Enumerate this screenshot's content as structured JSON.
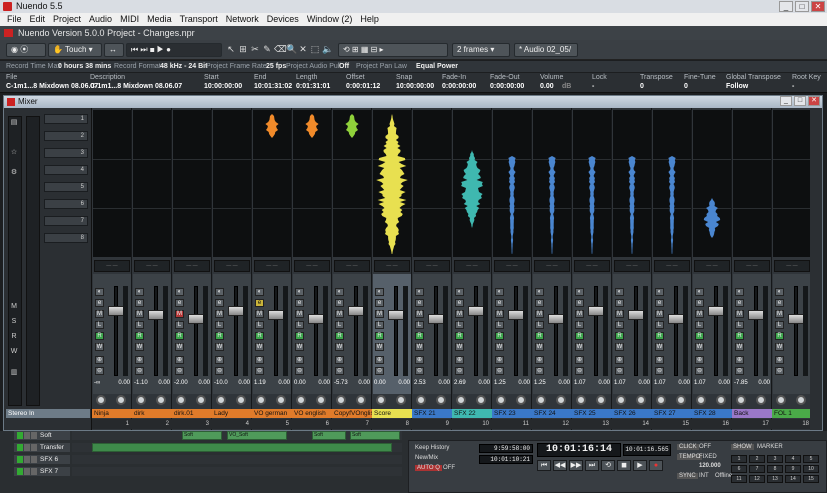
{
  "app": {
    "title": "Nuendo 5.5",
    "project_title": "Nuendo Version 5.0.0 Project - Changes.npr"
  },
  "menu": [
    "File",
    "Edit",
    "Project",
    "Audio",
    "MIDI",
    "Media",
    "Transport",
    "Network",
    "Devices",
    "Window (2)",
    "Help"
  ],
  "toolbar": {
    "automation_mode": "Touch",
    "frames": "2 frames",
    "audio_track": "* Audio 02_05/"
  },
  "status": [
    {
      "label": "Record Time Max",
      "value": "0 hours 38 mins"
    },
    {
      "label": "Record Format",
      "value": "48 kHz - 24 Bit"
    },
    {
      "label": "Project Frame Rate",
      "value": "25 fps"
    },
    {
      "label": "Project Audio Pull",
      "value": "Off"
    },
    {
      "label": "Project Pan Law",
      "value": "Equal Power"
    }
  ],
  "info": {
    "headers": [
      "File",
      "Description",
      "Start",
      "End",
      "Length",
      "Offset",
      "Snap",
      "Fade-In",
      "Fade-Out",
      "Volume",
      "Lock",
      "Transpose",
      "Fine-Tune",
      "Global Transpose",
      "Root Key"
    ],
    "values": [
      "C-1m1...8 Mixdown 08.06.07",
      "C-1m1...8 Mixdown 08.06.07",
      "10:00:00:00",
      "10:01:31:02",
      "0:01:31:01",
      "0:00:01:12",
      "10:00:00:00",
      "0:00:00:00",
      "0:00:00:00",
      "0.00",
      "-",
      "0",
      "0",
      "Follow",
      "-"
    ],
    "volume_unit": "dB"
  },
  "mixer": {
    "title": "Mixer",
    "channels": [
      {
        "name": "Ninja",
        "num": "1",
        "left": "-∞",
        "right": "0.00",
        "color": "#e07b2a",
        "wave": "none",
        "waveColor": "#e07b2a"
      },
      {
        "name": "dirk",
        "num": "2",
        "left": "-1.10",
        "right": "0.00",
        "color": "#e07b2a",
        "wave": "none",
        "waveColor": "#e07b2a"
      },
      {
        "name": "dirk.01",
        "num": "3",
        "left": "-2.00",
        "right": "0.00",
        "color": "#e07b2a",
        "wave": "none",
        "waveColor": "#e07b2a"
      },
      {
        "name": "Lady",
        "num": "4",
        "left": "-10.0",
        "right": "0.00",
        "color": "#e07b2a",
        "wave": "none",
        "waveColor": "#e07b2a"
      },
      {
        "name": "VO german",
        "num": "5",
        "left": "1.19",
        "right": "0.00",
        "color": "#e07b2a",
        "wave": "top",
        "waveColor": "#f08a2a"
      },
      {
        "name": "VO english",
        "num": "6",
        "left": "0.00",
        "right": "0.00",
        "color": "#e07b2a",
        "wave": "top",
        "waveColor": "#f08a2a"
      },
      {
        "name": "CopyfVOnglish",
        "num": "7",
        "left": "-5.73",
        "right": "0.00",
        "color": "#e07b2a",
        "wave": "top",
        "waveColor": "#8fd13a"
      },
      {
        "name": "Score",
        "num": "8",
        "left": "0.00",
        "right": "0.00",
        "color": "#e8e050",
        "wave": "full",
        "waveColor": "#e8e050"
      },
      {
        "name": "SFX 21",
        "num": "9",
        "left": "2.53",
        "right": "0.00",
        "color": "#3a78c8",
        "wave": "none",
        "waveColor": "#3fb8b0"
      },
      {
        "name": "SFX 22",
        "num": "10",
        "left": "2.69",
        "right": "0.00",
        "color": "#3fb8b0",
        "wave": "mid",
        "waveColor": "#3fb8b0"
      },
      {
        "name": "SFX 23",
        "num": "11",
        "left": "1.25",
        "right": "0.00",
        "color": "#3a78c8",
        "wave": "spike",
        "waveColor": "#4a86d0"
      },
      {
        "name": "SFX 24",
        "num": "12",
        "left": "1.25",
        "right": "0.00",
        "color": "#3a78c8",
        "wave": "spike",
        "waveColor": "#4a86d0"
      },
      {
        "name": "SFX 25",
        "num": "13",
        "left": "1.07",
        "right": "0.00",
        "color": "#3a78c8",
        "wave": "spike",
        "waveColor": "#4a86d0"
      },
      {
        "name": "SFX 26",
        "num": "14",
        "left": "1.07",
        "right": "0.00",
        "color": "#3a78c8",
        "wave": "spike",
        "waveColor": "#4a86d0"
      },
      {
        "name": "SFX 27",
        "num": "15",
        "left": "1.07",
        "right": "0.00",
        "color": "#3a78c8",
        "wave": "spike",
        "waveColor": "#4a86d0"
      },
      {
        "name": "SFX 28",
        "num": "16",
        "left": "1.07",
        "right": "0.00",
        "color": "#3a78c8",
        "wave": "small",
        "waveColor": "#4a86d0"
      },
      {
        "name": "Back",
        "num": "17",
        "left": "-7.85",
        "right": "0.00",
        "color": "#9a78c8",
        "wave": "none",
        "waveColor": "#4a86d0"
      },
      {
        "name": "FOL 1",
        "num": "18",
        "left": "",
        "right": "",
        "color": "#4aaa48",
        "wave": "none",
        "waveColor": "#4a86d0"
      }
    ],
    "left_labels": [
      "1",
      "2",
      "3",
      "4",
      "5",
      "6",
      "7",
      "8"
    ],
    "stereo_in": "Stereo In"
  },
  "tracks": [
    {
      "name": "Soft"
    },
    {
      "name": "Transfer"
    },
    {
      "name": "SFX 6"
    },
    {
      "name": "SFX 7"
    }
  ],
  "transport": {
    "keep_history": "Keep History",
    "new_mix": "New/Mix",
    "auto_q": "AUTO Q",
    "off1": "OFF",
    "time1": "9:59:58:00",
    "time2": "10:01:10:21",
    "position": "10:01:16:14",
    "secondary": "10:01:16.565",
    "click": "CLICK",
    "click_state": "OFF",
    "tempo": "TEMPO",
    "tempo_val": "120.000",
    "fixed": "FIXED",
    "sync": "SYNC",
    "int": "INT",
    "offline": "Offline",
    "show": "SHOW",
    "markers": "MARKER"
  }
}
